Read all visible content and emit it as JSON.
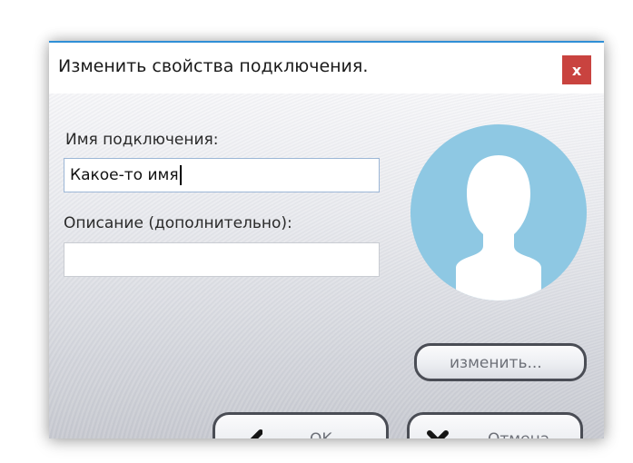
{
  "dialog": {
    "title": "Изменить свойства подключения.",
    "close_label": "x",
    "accent_color": "#2f8fd6",
    "close_color": "#c9433f"
  },
  "form": {
    "name_label": "Имя подключения:",
    "name_value": "Какое-то имя",
    "description_label": "Описание (дополнительно):",
    "description_value": ""
  },
  "avatar": {
    "icon": "user-silhouette-icon",
    "color": "#8ec8e3"
  },
  "buttons": {
    "change_label": "изменить...",
    "ok_label": "OK",
    "ok_icon": "checkmark-icon",
    "cancel_label": "Отмена",
    "cancel_icon": "cross-icon"
  }
}
